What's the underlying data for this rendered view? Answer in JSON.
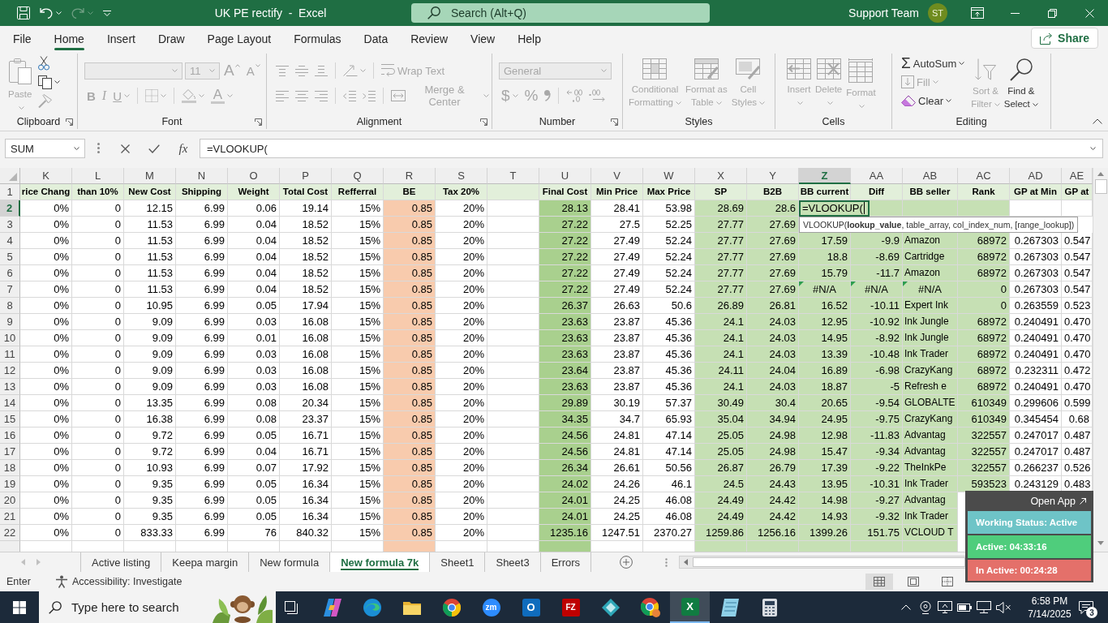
{
  "title_bar": {
    "quick_access": [
      {
        "kind": "save",
        "disabled": false,
        "menu": false
      },
      {
        "kind": "undo",
        "disabled": false,
        "menu": true
      },
      {
        "kind": "redo",
        "disabled": true,
        "menu": true
      },
      {
        "kind": "customize",
        "disabled": false,
        "menu": false
      }
    ],
    "title": "UK PE rectify  -  Excel",
    "search": {
      "placeholder": "Search (Alt+Q)"
    },
    "user": "Support Team",
    "avatar": "ST"
  },
  "menu_tabs": [
    {
      "label": "File",
      "selected": false
    },
    {
      "label": "Home",
      "selected": true
    },
    {
      "label": "Insert",
      "selected": false
    },
    {
      "label": "Draw",
      "selected": false
    },
    {
      "label": "Page Layout",
      "selected": false
    },
    {
      "label": "Formulas",
      "selected": false
    },
    {
      "label": "Data",
      "selected": false
    },
    {
      "label": "Review",
      "selected": false
    },
    {
      "label": "View",
      "selected": false
    },
    {
      "label": "Help",
      "selected": false
    }
  ],
  "share": "Share",
  "ribbon": {
    "groups": [
      {
        "label": "Clipboard",
        "launcher": true,
        "parts": [
          {
            "kind": "large",
            "items": [
              {
                "kind": "paste",
                "label": "Paste",
                "disabled": true,
                "menu": true
              }
            ]
          },
          {
            "kind": "stack",
            "rows": [
              [
                {
                  "kind": "cut",
                  "disabled": false,
                  "menu": false
                }
              ],
              [
                {
                  "kind": "copy",
                  "disabled": false,
                  "menu": true
                }
              ],
              [
                {
                  "kind": "format_painter",
                  "disabled": true,
                  "menu": false
                }
              ]
            ]
          }
        ]
      },
      {
        "label": "Font",
        "launcher": true,
        "parts": [
          {
            "kind": "stack",
            "rows": [
              [
                {
                  "kind": "font_name",
                  "disabled": true,
                  "menu": true
                },
                {
                  "kind": "font_size",
                  "value": "11",
                  "disabled": true,
                  "menu": true
                },
                {
                  "kind": "grow_font",
                  "label": "A",
                  "disabled": true,
                  "menu": false
                },
                {
                  "kind": "shrink_font",
                  "label": "A",
                  "disabled": true,
                  "menu": false
                }
              ],
              [
                {
                  "kind": "bold",
                  "label": "B",
                  "disabled": true,
                  "menu": false
                },
                {
                  "kind": "italic",
                  "label": "I",
                  "disabled": true,
                  "menu": false
                },
                {
                  "kind": "underline",
                  "label": "U",
                  "disabled": true,
                  "menu": true
                },
                {
                  "kind": "separator"
                },
                {
                  "kind": "borders",
                  "disabled": true,
                  "menu": true
                },
                {
                  "kind": "separator"
                },
                {
                  "kind": "fill_color",
                  "disabled": true,
                  "menu": true
                },
                {
                  "kind": "font_color",
                  "label": "A",
                  "disabled": true,
                  "menu": true
                }
              ]
            ]
          }
        ]
      },
      {
        "label": "Alignment",
        "launcher": true,
        "parts": [
          {
            "kind": "stack",
            "rows": [
              [
                {
                  "kind": "top_align",
                  "disabled": true,
                  "menu": false
                },
                {
                  "kind": "middle_align",
                  "disabled": true,
                  "menu": false
                },
                {
                  "kind": "bottom_align",
                  "disabled": true,
                  "menu": false
                },
                {
                  "kind": "separator"
                },
                {
                  "kind": "orientation",
                  "disabled": true,
                  "menu": true
                },
                {
                  "kind": "separator"
                },
                {
                  "kind": "wrap_text",
                  "label": "Wrap Text",
                  "disabled": true,
                  "menu": false
                }
              ],
              [
                {
                  "kind": "align_left",
                  "disabled": true,
                  "menu": false
                },
                {
                  "kind": "align_center",
                  "disabled": true,
                  "menu": false
                },
                {
                  "kind": "align_right",
                  "disabled": true,
                  "menu": false
                },
                {
                  "kind": "separator"
                },
                {
                  "kind": "decrease_indent",
                  "disabled": true,
                  "menu": false
                },
                {
                  "kind": "increase_indent",
                  "disabled": true,
                  "menu": false
                },
                {
                  "kind": "separator"
                },
                {
                  "kind": "merge_center",
                  "label": "Merge & Center",
                  "disabled": true,
                  "menu": true
                }
              ]
            ]
          }
        ]
      },
      {
        "label": "Number",
        "launcher": true,
        "parts": [
          {
            "kind": "stack",
            "rows": [
              [
                {
                  "kind": "number_format",
                  "value": "General",
                  "disabled": true,
                  "menu": true
                }
              ],
              [
                {
                  "kind": "currency",
                  "label": "$",
                  "disabled": true,
                  "menu": true
                },
                {
                  "kind": "percent",
                  "label": "%",
                  "disabled": true,
                  "menu": false
                },
                {
                  "kind": "comma",
                  "disabled": true,
                  "menu": false
                },
                {
                  "kind": "separator"
                },
                {
                  "kind": "increase_decimal",
                  "disabled": true,
                  "menu": false
                },
                {
                  "kind": "decrease_decimal",
                  "disabled": true,
                  "menu": false
                }
              ]
            ]
          }
        ]
      },
      {
        "label": "Styles",
        "launcher": false,
        "parts": [
          {
            "kind": "large",
            "items": [
              {
                "kind": "conditional_formatting",
                "label": "Conditional Formatting",
                "disabled": true,
                "menu": true
              },
              {
                "kind": "format_table",
                "label": "Format as Table",
                "disabled": true,
                "menu": true
              },
              {
                "kind": "cell_styles",
                "label": "Cell Styles",
                "disabled": true,
                "menu": true
              }
            ]
          }
        ]
      },
      {
        "label": "Cells",
        "launcher": false,
        "parts": [
          {
            "kind": "large",
            "items": [
              {
                "kind": "insert",
                "label": "Insert",
                "disabled": true,
                "menu": true
              },
              {
                "kind": "delete",
                "label": "Delete",
                "disabled": true,
                "menu": true
              },
              {
                "kind": "format",
                "label": "Format",
                "disabled": true,
                "menu": true
              }
            ]
          }
        ]
      },
      {
        "label": "Editing",
        "launcher": false,
        "parts": [
          {
            "kind": "stack",
            "rows": [
              [
                {
                  "kind": "autosum",
                  "symbol": "Σ",
                  "label": "AutoSum",
                  "disabled": false,
                  "menu": true
                }
              ],
              [
                {
                  "kind": "fill",
                  "label": "Fill",
                  "disabled": true,
                  "menu": true
                }
              ],
              [
                {
                  "kind": "clear",
                  "label": "Clear",
                  "disabled": false,
                  "menu": true
                }
              ]
            ]
          },
          {
            "kind": "large",
            "items": [
              {
                "kind": "sort_filter",
                "label": "Sort & Filter",
                "disabled": true,
                "menu": true
              },
              {
                "kind": "find_select",
                "label": "Find & Select",
                "disabled": false,
                "menu": true
              }
            ]
          }
        ]
      }
    ]
  },
  "formula_bar": {
    "name_box": "SUM",
    "function_button": "fx",
    "formula": "=VLOOKUP("
  },
  "sheet": {
    "columns": [
      {
        "label": "K",
        "selected": false,
        "kind": "number",
        "color": "#ffffff"
      },
      {
        "label": "L",
        "selected": false,
        "kind": "number",
        "color": "#ffffff"
      },
      {
        "label": "M",
        "selected": false,
        "kind": "number",
        "color": "#ffffff"
      },
      {
        "label": "N",
        "selected": false,
        "kind": "number",
        "color": "#ffffff"
      },
      {
        "label": "O",
        "selected": false,
        "kind": "number",
        "color": "#ffffff"
      },
      {
        "label": "P",
        "selected": false,
        "kind": "number",
        "color": "#ffffff"
      },
      {
        "label": "Q",
        "selected": false,
        "kind": "number",
        "color": "#ffffff"
      },
      {
        "label": "R",
        "selected": false,
        "kind": "number",
        "color": "#f8cbad"
      },
      {
        "label": "S",
        "selected": false,
        "kind": "number",
        "color": "#ffffff"
      },
      {
        "label": "T",
        "selected": false,
        "kind": "number",
        "color": "#ffffff"
      },
      {
        "label": "U",
        "selected": false,
        "kind": "number",
        "color": "#a9d08e"
      },
      {
        "label": "V",
        "selected": false,
        "kind": "number",
        "color": "#ffffff"
      },
      {
        "label": "W",
        "selected": false,
        "kind": "number",
        "color": "#ffffff"
      },
      {
        "label": "X",
        "selected": false,
        "kind": "number",
        "color": "#c6e0b4"
      },
      {
        "label": "Y",
        "selected": false,
        "kind": "number",
        "color": "#c6e0b4"
      },
      {
        "label": "Z",
        "selected": true,
        "kind": "number",
        "color": "#c6e0b4"
      },
      {
        "label": "AA",
        "selected": false,
        "kind": "number",
        "color": "#c6e0b4"
      },
      {
        "label": "AB",
        "selected": false,
        "kind": "text",
        "color": "#c6e0b4"
      },
      {
        "label": "AC",
        "selected": false,
        "kind": "number",
        "color": "#c6e0b4"
      },
      {
        "label": "AD",
        "selected": false,
        "kind": "number",
        "color": "#ffffff"
      },
      {
        "label": "AE",
        "selected": false,
        "kind": "number",
        "color": "#ffffff"
      }
    ],
    "rows": [
      {
        "label": "1",
        "selected": false,
        "kind": "header",
        "cells": [
          "rice Chang",
          "than 10%",
          "New Cost",
          "Shipping",
          "Weight",
          "Total Cost",
          "Refferral",
          "BE",
          "Tax 20%",
          null,
          "Final Cost",
          "Min Price",
          "Max Price",
          "SP",
          "B2B",
          "BB current",
          "Diff",
          "BB seller",
          "Rank",
          "GP at Min",
          "GP at"
        ]
      },
      {
        "label": "2",
        "selected": true,
        "kind": "data",
        "cells": [
          "0%",
          "0",
          "12.15",
          "6.99",
          "0.06",
          "19.14",
          "15%",
          "0.85",
          "20%",
          null,
          "28.13",
          "28.41",
          "53.98",
          "28.69",
          "28.6",
          {
            "kind": "editing",
            "text": "=VLOOKUP("
          },
          null,
          null,
          null,
          null,
          null
        ]
      },
      {
        "label": "3",
        "selected": false,
        "kind": "data",
        "cells": [
          "0%",
          "0",
          "11.53",
          "6.99",
          "0.04",
          "18.52",
          "15%",
          "0.85",
          "20%",
          null,
          "27.22",
          "27.5",
          "52.25",
          "27.77",
          "27.69"
        ]
      },
      {
        "label": "4",
        "selected": false,
        "kind": "data",
        "cells": [
          "0%",
          "0",
          "11.53",
          "6.99",
          "0.04",
          "18.52",
          "15%",
          "0.85",
          "20%",
          null,
          "27.22",
          "27.49",
          "52.24",
          "27.77",
          "27.69",
          "17.59",
          "-9.9",
          "Amazon",
          "68972",
          "0.267303",
          "0.547"
        ]
      },
      {
        "label": "5",
        "selected": false,
        "kind": "data",
        "cells": [
          "0%",
          "0",
          "11.53",
          "6.99",
          "0.04",
          "18.52",
          "15%",
          "0.85",
          "20%",
          null,
          "27.22",
          "27.49",
          "52.24",
          "27.77",
          "27.69",
          "18.8",
          "-8.69",
          "Cartridge",
          "68972",
          "0.267303",
          "0.547"
        ]
      },
      {
        "label": "6",
        "selected": false,
        "kind": "data",
        "cells": [
          "0%",
          "0",
          "11.53",
          "6.99",
          "0.04",
          "18.52",
          "15%",
          "0.85",
          "20%",
          null,
          "27.22",
          "27.49",
          "52.24",
          "27.77",
          "27.69",
          "15.79",
          "-11.7",
          "Amazon",
          "68972",
          "0.267303",
          "0.547"
        ]
      },
      {
        "label": "7",
        "selected": false,
        "kind": "data",
        "cells": [
          "0%",
          "0",
          "11.53",
          "6.99",
          "0.04",
          "18.52",
          "15%",
          "0.85",
          "20%",
          null,
          "27.22",
          "27.49",
          "52.24",
          "27.77",
          "27.69",
          {
            "kind": "error",
            "text": "#N/A"
          },
          {
            "kind": "error",
            "text": "#N/A"
          },
          {
            "kind": "error",
            "text": "#N/A"
          },
          "0",
          "0.267303",
          "0.547"
        ]
      },
      {
        "label": "8",
        "selected": false,
        "kind": "data",
        "cells": [
          "0%",
          "0",
          "10.95",
          "6.99",
          "0.05",
          "17.94",
          "15%",
          "0.85",
          "20%",
          null,
          "26.37",
          "26.63",
          "50.6",
          "26.89",
          "26.81",
          "16.52",
          "-10.11",
          "Expert Ink",
          "0",
          "0.263559",
          "0.523"
        ]
      },
      {
        "label": "9",
        "selected": false,
        "kind": "data",
        "cells": [
          "0%",
          "0",
          "9.09",
          "6.99",
          "0.03",
          "16.08",
          "15%",
          "0.85",
          "20%",
          null,
          "23.63",
          "23.87",
          "45.36",
          "24.1",
          "24.03",
          "12.95",
          "-10.92",
          "Ink Jungle",
          "68972",
          "0.240491",
          "0.470"
        ]
      },
      {
        "label": "10",
        "selected": false,
        "kind": "data",
        "cells": [
          "0%",
          "0",
          "9.09",
          "6.99",
          "0.01",
          "16.08",
          "15%",
          "0.85",
          "20%",
          null,
          "23.63",
          "23.87",
          "45.36",
          "24.1",
          "24.03",
          "14.95",
          "-8.92",
          "Ink Jungle",
          "68972",
          "0.240491",
          "0.470"
        ]
      },
      {
        "label": "11",
        "selected": false,
        "kind": "data",
        "cells": [
          "0%",
          "0",
          "9.09",
          "6.99",
          "0.03",
          "16.08",
          "15%",
          "0.85",
          "20%",
          null,
          "23.63",
          "23.87",
          "45.36",
          "24.1",
          "24.03",
          "13.39",
          "-10.48",
          "Ink Trader",
          "68972",
          "0.240491",
          "0.470"
        ]
      },
      {
        "label": "12",
        "selected": false,
        "kind": "data",
        "cells": [
          "0%",
          "0",
          "9.09",
          "6.99",
          "0.03",
          "16.08",
          "15%",
          "0.85",
          "20%",
          null,
          "23.64",
          "23.87",
          "45.36",
          "24.11",
          "24.04",
          "16.89",
          "-6.98",
          "CrazyKang",
          "68972",
          "0.232311",
          "0.472"
        ]
      },
      {
        "label": "13",
        "selected": false,
        "kind": "data",
        "cells": [
          "0%",
          "0",
          "9.09",
          "6.99",
          "0.03",
          "16.08",
          "15%",
          "0.85",
          "20%",
          null,
          "23.63",
          "23.87",
          "45.36",
          "24.1",
          "24.03",
          "18.87",
          "-5",
          "Refresh e",
          "68972",
          "0.240491",
          "0.470"
        ]
      },
      {
        "label": "14",
        "selected": false,
        "kind": "data",
        "cells": [
          "0%",
          "0",
          "13.35",
          "6.99",
          "0.08",
          "20.34",
          "15%",
          "0.85",
          "20%",
          null,
          "29.89",
          "30.19",
          "57.37",
          "30.49",
          "30.4",
          "20.65",
          "-9.54",
          "GLOBALTE",
          "610349",
          "0.299606",
          "0.599"
        ]
      },
      {
        "label": "15",
        "selected": false,
        "kind": "data",
        "cells": [
          "0%",
          "0",
          "16.38",
          "6.99",
          "0.08",
          "23.37",
          "15%",
          "0.85",
          "20%",
          null,
          "34.35",
          "34.7",
          "65.93",
          "35.04",
          "34.94",
          "24.95",
          "-9.75",
          "CrazyKang",
          "610349",
          "0.345454",
          "0.68"
        ]
      },
      {
        "label": "16",
        "selected": false,
        "kind": "data",
        "cells": [
          "0%",
          "0",
          "9.72",
          "6.99",
          "0.05",
          "16.71",
          "15%",
          "0.85",
          "20%",
          null,
          "24.56",
          "24.81",
          "47.14",
          "25.05",
          "24.98",
          "12.98",
          "-11.83",
          "Advantag",
          "322557",
          "0.247017",
          "0.487"
        ]
      },
      {
        "label": "17",
        "selected": false,
        "kind": "data",
        "cells": [
          "0%",
          "0",
          "9.72",
          "6.99",
          "0.04",
          "16.71",
          "15%",
          "0.85",
          "20%",
          null,
          "24.56",
          "24.81",
          "47.14",
          "25.05",
          "24.98",
          "15.47",
          "-9.34",
          "Advantag",
          "322557",
          "0.247017",
          "0.487"
        ]
      },
      {
        "label": "18",
        "selected": false,
        "kind": "data",
        "cells": [
          "0%",
          "0",
          "10.93",
          "6.99",
          "0.07",
          "17.92",
          "15%",
          "0.85",
          "20%",
          null,
          "26.34",
          "26.61",
          "50.56",
          "26.87",
          "26.79",
          "17.39",
          "-9.22",
          "TheInkPe",
          "322557",
          "0.266237",
          "0.526"
        ]
      },
      {
        "label": "19",
        "selected": false,
        "kind": "data",
        "cells": [
          "0%",
          "0",
          "9.35",
          "6.99",
          "0.05",
          "16.34",
          "15%",
          "0.85",
          "20%",
          null,
          "24.02",
          "24.26",
          "46.1",
          "24.5",
          "24.43",
          "13.95",
          "-10.31",
          "Ink Trader",
          "593523",
          "0.243129",
          "0.483"
        ]
      },
      {
        "label": "20",
        "selected": false,
        "kind": "data",
        "cells": [
          "0%",
          "0",
          "9.35",
          "6.99",
          "0.05",
          "16.34",
          "15%",
          "0.85",
          "20%",
          null,
          "24.01",
          "24.25",
          "46.08",
          "24.49",
          "24.42",
          "14.98",
          "-9.27",
          "Advantag"
        ]
      },
      {
        "label": "21",
        "selected": false,
        "kind": "data",
        "cells": [
          "0%",
          "0",
          "9.35",
          "6.99",
          "0.05",
          "16.34",
          "15%",
          "0.85",
          "20%",
          null,
          "24.01",
          "24.25",
          "46.08",
          "24.49",
          "24.42",
          "14.93",
          "-9.32",
          "Ink Trader"
        ]
      },
      {
        "label": "22",
        "selected": false,
        "kind": "data",
        "cells": [
          "0%",
          "0",
          "833.33",
          "6.99",
          "76",
          "840.32",
          "15%",
          "0.85",
          "20%",
          null,
          "1235.16",
          "1247.51",
          "2370.27",
          "1259.86",
          "1256.16",
          "1399.26",
          "151.75",
          "VCLOUD T"
        ]
      }
    ]
  },
  "tooltip": "VLOOKUP(**lookup_value**, table_array, col_index_num, [range_lookup])",
  "sheet_tabs": [
    {
      "label": "Active listing",
      "selected": false
    },
    {
      "label": "Keepa margin",
      "selected": false
    },
    {
      "label": "New formula",
      "selected": false
    },
    {
      "label": "New formula 7k",
      "selected": true
    },
    {
      "label": "Sheet1",
      "selected": false
    },
    {
      "label": "Sheet3",
      "selected": false
    },
    {
      "label": "Errors",
      "selected": false
    }
  ],
  "status_bar": {
    "mode": "Enter",
    "accessibility": "Accessibility: Investigate",
    "views": [
      {
        "kind": "normal",
        "selected": true
      },
      {
        "kind": "page_layout",
        "selected": false
      },
      {
        "kind": "page_break",
        "selected": false
      }
    ]
  },
  "timer_widget": {
    "link": "Open App",
    "status": "Working Status: Active",
    "active": "Active: 04:33:16",
    "inactive": "In Active: 00:24:28"
  },
  "taskbar": {
    "search": {
      "placeholder": "Type here to search"
    },
    "apps": [
      {
        "kind": "task_view",
        "selected": false
      },
      {
        "kind": "copilot",
        "selected": false
      },
      {
        "kind": "edge",
        "selected": false
      },
      {
        "kind": "explorer",
        "selected": false
      },
      {
        "kind": "chrome",
        "selected": false
      },
      {
        "kind": "zoom",
        "label": "zm",
        "selected": false
      },
      {
        "kind": "outlook",
        "label": "O",
        "selected": false
      },
      {
        "kind": "filezilla",
        "label": "FZ",
        "selected": false
      },
      {
        "kind": "diamond",
        "selected": false
      },
      {
        "kind": "chrome_profile",
        "selected": false
      },
      {
        "kind": "excel",
        "label": "X",
        "selected": true
      },
      {
        "kind": "notepad",
        "selected": false
      },
      {
        "kind": "calculator",
        "selected": false
      }
    ],
    "time": "6:58 PM",
    "date": "7/14/2025",
    "notifications": "3"
  }
}
